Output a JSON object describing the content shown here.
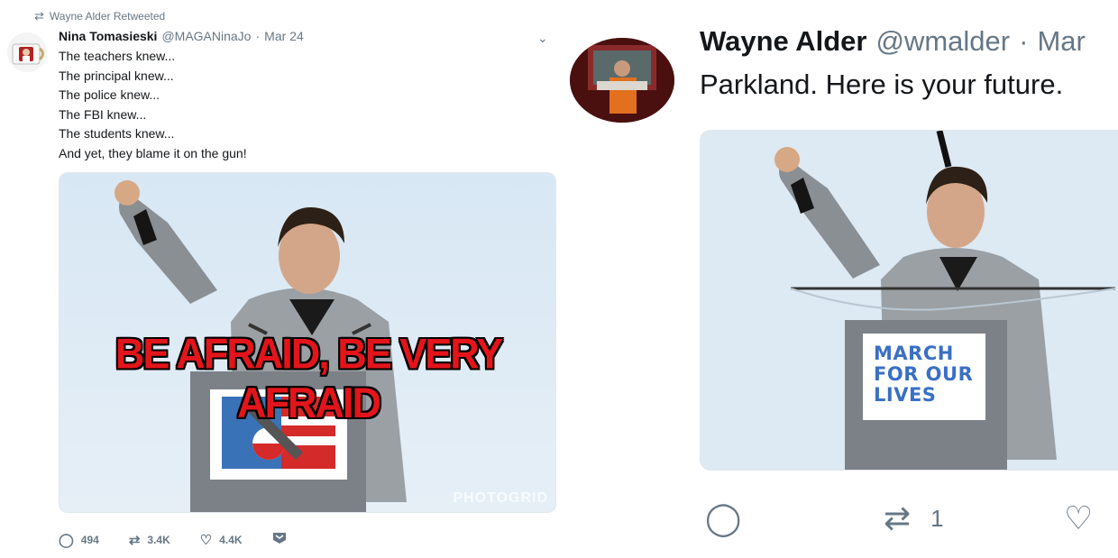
{
  "left_tweet": {
    "retweet_label": "Wayne Alder Retweeted",
    "author_name": "Nina Tomasieski",
    "author_handle": "@MAGANinaJo",
    "separator": "·",
    "date": "Mar 24",
    "lines": [
      "The teachers knew...",
      "The principal knew...",
      "The police knew...",
      "The FBI knew...",
      "The students knew...",
      "And yet, they blame it on the gun!"
    ],
    "image_caption": "BE AFRAID, BE VERY AFRAID",
    "watermark": "PHOTOGRID",
    "reply_count": "494",
    "retweet_count": "3.4K",
    "like_count": "4.4K"
  },
  "right_tweet": {
    "author_name": "Wayne Alder",
    "author_handle": "@wmalder",
    "separator": "·",
    "date_partial": "Mar",
    "text": "Parkland. Here is your future.",
    "sign_line1": "MARCH",
    "sign_line2": "FOR OUR",
    "sign_line3": "LIVES",
    "retweet_count": "1"
  },
  "colors": {
    "text_primary": "#14171a",
    "text_secondary": "#657786",
    "caption_red": "#e3151b",
    "sign_blue": "#3a6fc4"
  },
  "icons": [
    "retweet-icon",
    "chevron-down-icon",
    "reply-icon",
    "like-icon",
    "dm-icon"
  ]
}
